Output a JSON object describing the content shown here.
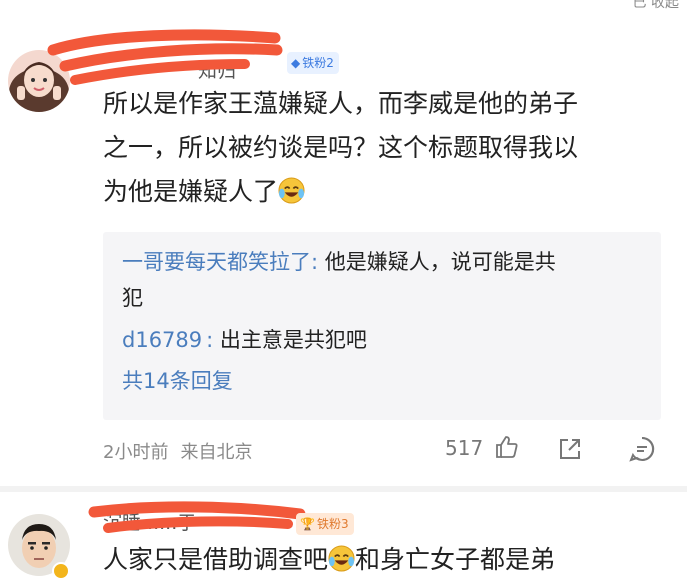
{
  "header": {
    "partial_text": "已  收起"
  },
  "comments": [
    {
      "username": "知归",
      "badge": "铁粉2",
      "text_lines": [
        "所以是作家王蕰嫌疑人，而李威是他的弟子",
        "之一，所以被约谈是吗？这个标题取得我以",
        "为他是嫌疑人了"
      ],
      "emoji": "laugh-cry-emoji",
      "replies": [
        {
          "author": "一哥要每天都笑拉了",
          "sep": ":",
          "text": "他是嫌疑人，说可能是共",
          "text_cont": "犯"
        },
        {
          "author": "d16789",
          "sep": ":",
          "text": "出主意是共犯吧"
        }
      ],
      "more_replies": "共14条回复",
      "time": "2小时前",
      "location": "来自北京",
      "likes": "517"
    },
    {
      "username": "沉睡......于",
      "badge": "铁粉3",
      "text_line": "人家只是借助调查吧",
      "text_after_emoji": "和身亡女子都是弟"
    }
  ],
  "colors": {
    "link": "#4a7dbd",
    "scribble": "#f2583a",
    "meta": "#8a8a8a"
  }
}
